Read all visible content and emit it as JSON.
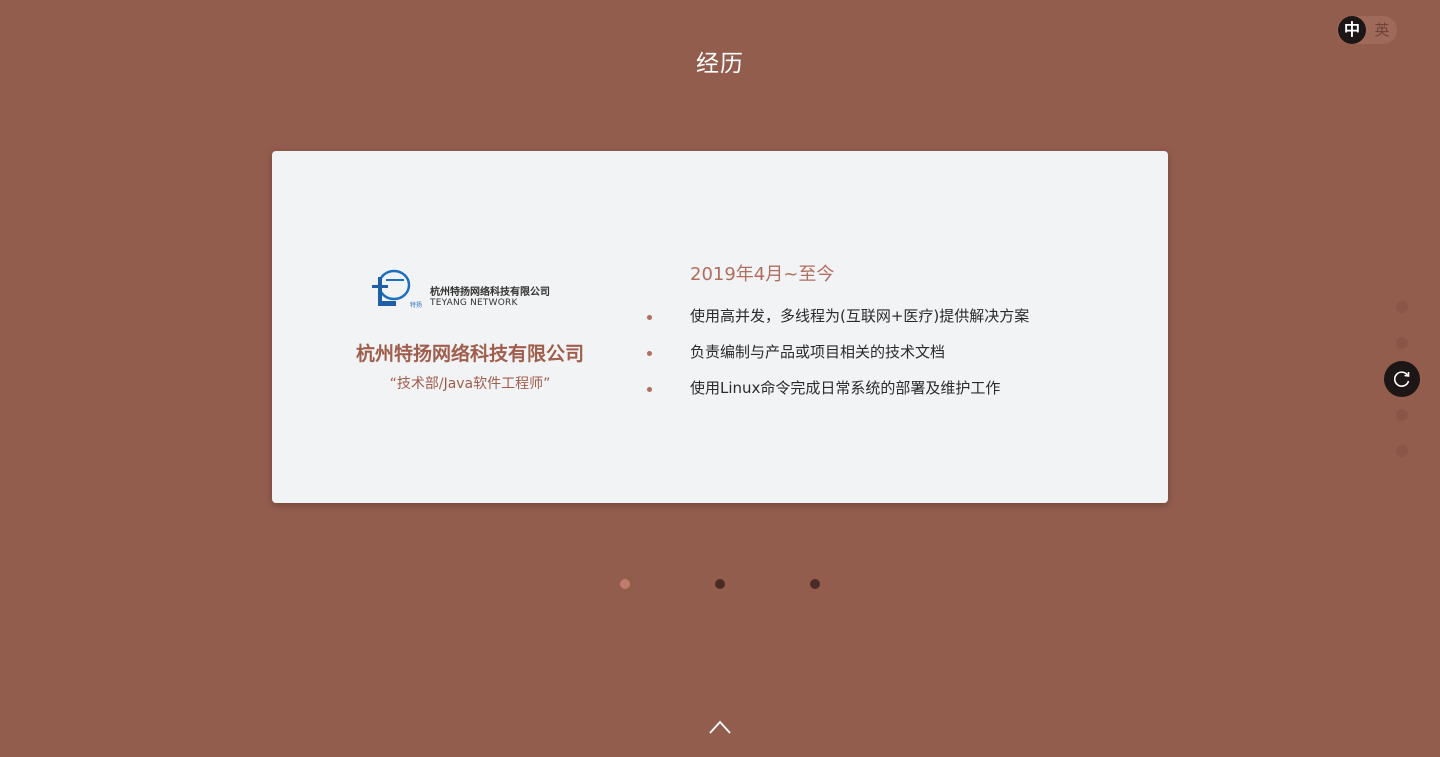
{
  "section": {
    "title": "经历"
  },
  "language": {
    "zh_label": "中",
    "en_label": "英",
    "active": "zh"
  },
  "experience": {
    "logo": {
      "cn_text": "杭州特扬网络科技有限公司",
      "en_text": "TEYANG NETWORK",
      "mark_text": "特扬"
    },
    "company": "杭州特扬网络科技有限公司",
    "role": "“技术部/Java软件工程师”",
    "period": "2019年4月~至今",
    "duties": [
      "使用高并发，多线程为(互联网+医疗)提供解决方案",
      "负责编制与产品或项目相关的技术文档",
      "使用Linux命令完成日常系统的部署及维护工作"
    ]
  },
  "slides": {
    "count": 3,
    "active_index": 0
  },
  "side_nav": {
    "count": 5,
    "active_index": 2
  },
  "colors": {
    "background": "#935d4e",
    "card": "#f2f3f5",
    "accent": "#a05e4d",
    "dark": "#1d1616"
  },
  "icons": {
    "side_active": "refresh-icon",
    "scroll_up": "chevron-up-icon"
  }
}
